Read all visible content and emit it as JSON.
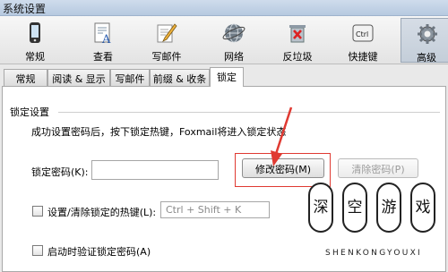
{
  "window": {
    "title": "系统设置"
  },
  "toolbar": [
    {
      "label": "常规",
      "icon": "phone-icon"
    },
    {
      "label": "查看",
      "icon": "document-font-icon"
    },
    {
      "label": "写邮件",
      "icon": "pencil-paper-icon"
    },
    {
      "label": "网络",
      "icon": "globe-icon"
    },
    {
      "label": "反垃圾",
      "icon": "trash-x-icon"
    },
    {
      "label": "快捷键",
      "icon": "ctrl-key-icon"
    },
    {
      "label": "高级",
      "icon": "gear-icon"
    }
  ],
  "tabs": [
    {
      "label": "常规"
    },
    {
      "label": "阅读 & 显示"
    },
    {
      "label": "写邮件"
    },
    {
      "label": "前缀 & 收条"
    },
    {
      "label": "锁定"
    }
  ],
  "lock": {
    "section_title": "锁定设置",
    "description": "成功设置密码后，按下锁定热键，Foxmail将进入锁定状态",
    "password_label": "锁定密码(K):",
    "password_value": "",
    "change_button": "修改密码(M)",
    "clear_button": "清除密码(P)",
    "hotkey_label": "设置/清除锁定的热键(L):",
    "hotkey_value": "Ctrl + Shift + K",
    "startup_label": "启动时验证锁定密码(A)"
  },
  "watermark": {
    "chars": [
      "深",
      "空",
      "游",
      "戏"
    ],
    "text": "SHENKONGYOUXI"
  },
  "colors": {
    "highlight": "#e03a32"
  }
}
